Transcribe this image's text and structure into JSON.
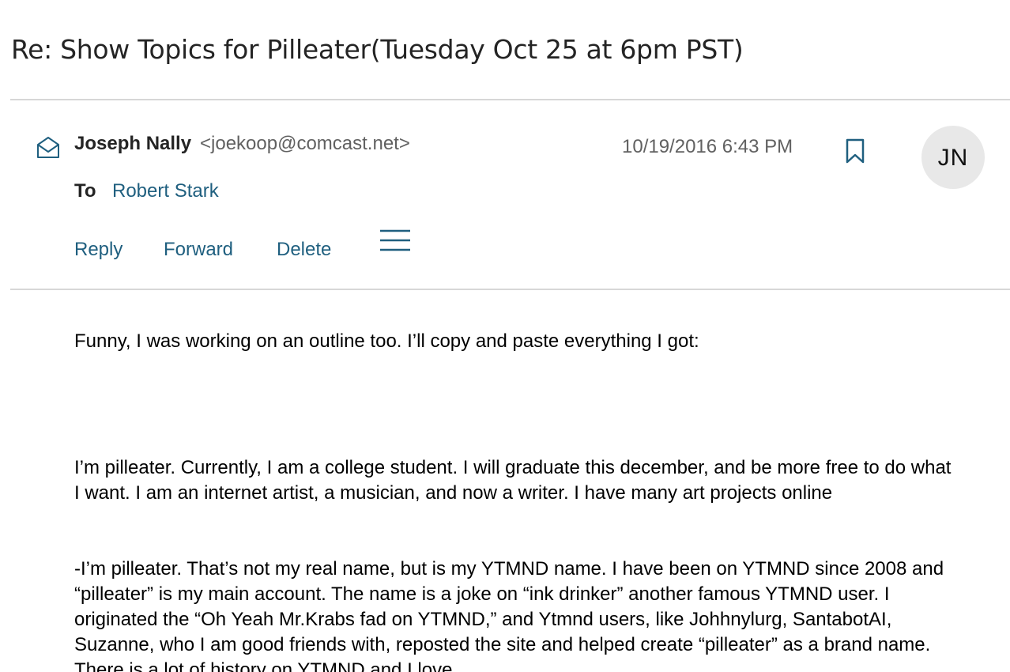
{
  "email": {
    "subject": "Re: Show Topics for Pilleater(Tuesday Oct 25 at 6pm PST)",
    "sender_name": "Joseph Nally",
    "sender_email": "<joekoop@comcast.net>",
    "date": "10/19/2016 6:43 PM",
    "avatar_initials": "JN",
    "to_label": "To",
    "to_recipient": "Robert Stark",
    "icons": {
      "read_status": "envelope-open-icon",
      "flag": "bookmark-icon",
      "more": "hamburger-menu-icon"
    },
    "colors": {
      "link": "#1f5f7f",
      "divider": "#d7d7d7",
      "avatar_bg": "#e8e8e8"
    }
  },
  "actions": {
    "reply": "Reply",
    "forward": "Forward",
    "delete": "Delete"
  },
  "body": {
    "paragraph_1": "Funny, I was working on an outline too. I’ll copy and paste everything I got:",
    "paragraph_2": "I’m pilleater. Currently, I am a college student. I will graduate this december, and be more free to do what I want. I am an internet artist, a musician, and now a writer. I have many art projects online",
    "paragraph_3": "-I’m pilleater. That’s not my real name, but is my YTMND name. I have been on YTMND since 2008 and “pilleater” is my main account. The name is a joke on “ink drinker” another famous YTMND user. I originated the “Oh Yeah Mr.Krabs fad on YTMND,” and Ytmnd users, like Johhnylurg, SantabotAI, Suzanne, who I am good friends with, reposted the site and helped create “pilleater” as a brand name. There is a lot of history on YTMND and I love"
  }
}
